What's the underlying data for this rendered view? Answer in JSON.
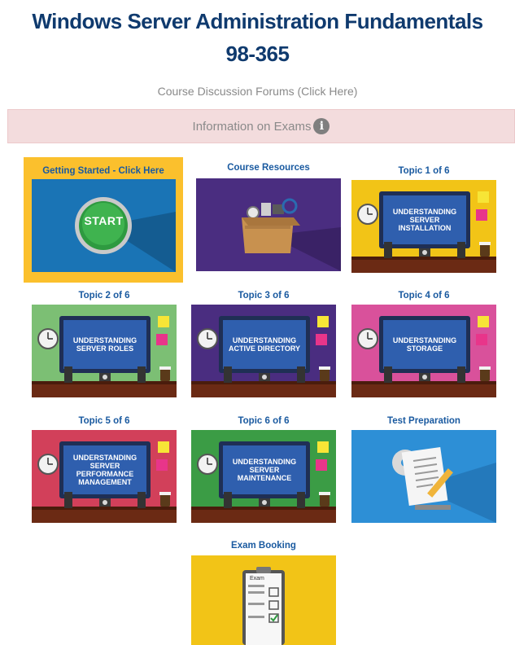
{
  "header": {
    "title_line1": "Windows Server Administration Fundamentals",
    "title_line2": "98-365"
  },
  "links": {
    "forums": "Course Discussion Forums (Click Here)",
    "exams_info": "Information on Exams"
  },
  "tiles": {
    "getting_started": {
      "label": "Getting Started - Click Here",
      "button_text": "START"
    },
    "course_resources": {
      "label": "Course Resources"
    },
    "topic1": {
      "label": "Topic 1 of 6",
      "screen_text": "UNDERSTANDING SERVER INSTALLATION",
      "bg": "#f2c417"
    },
    "topic2": {
      "label": "Topic 2 of 6",
      "screen_text": "UNDERSTANDING SERVER ROLES",
      "bg": "#7cbf74"
    },
    "topic3": {
      "label": "Topic 3 of 6",
      "screen_text": "UNDERSTANDING ACTIVE DIRECTORY",
      "bg": "#4a2d80"
    },
    "topic4": {
      "label": "Topic 4 of 6",
      "screen_text": "UNDERSTANDING STORAGE",
      "bg": "#d9519b"
    },
    "topic5": {
      "label": "Topic 5 of 6",
      "screen_text": "UNDERSTANDING SERVER PERFORMANCE MANAGEMENT",
      "bg": "#d2405a"
    },
    "topic6": {
      "label": "Topic 6 of 6",
      "screen_text": "UNDERSTANDING SERVER MAINTENANCE",
      "bg": "#3b9c45"
    },
    "test_prep": {
      "label": "Test Preparation"
    },
    "exam_booking": {
      "label": "Exam Booking",
      "form_text": "Exam"
    }
  },
  "colors": {
    "title": "#0f3a6e",
    "tile_label": "#1a5aa0",
    "info_bar": "#f3dcdd",
    "monitor": "#2f5fae",
    "desk": "#6b2a14"
  }
}
